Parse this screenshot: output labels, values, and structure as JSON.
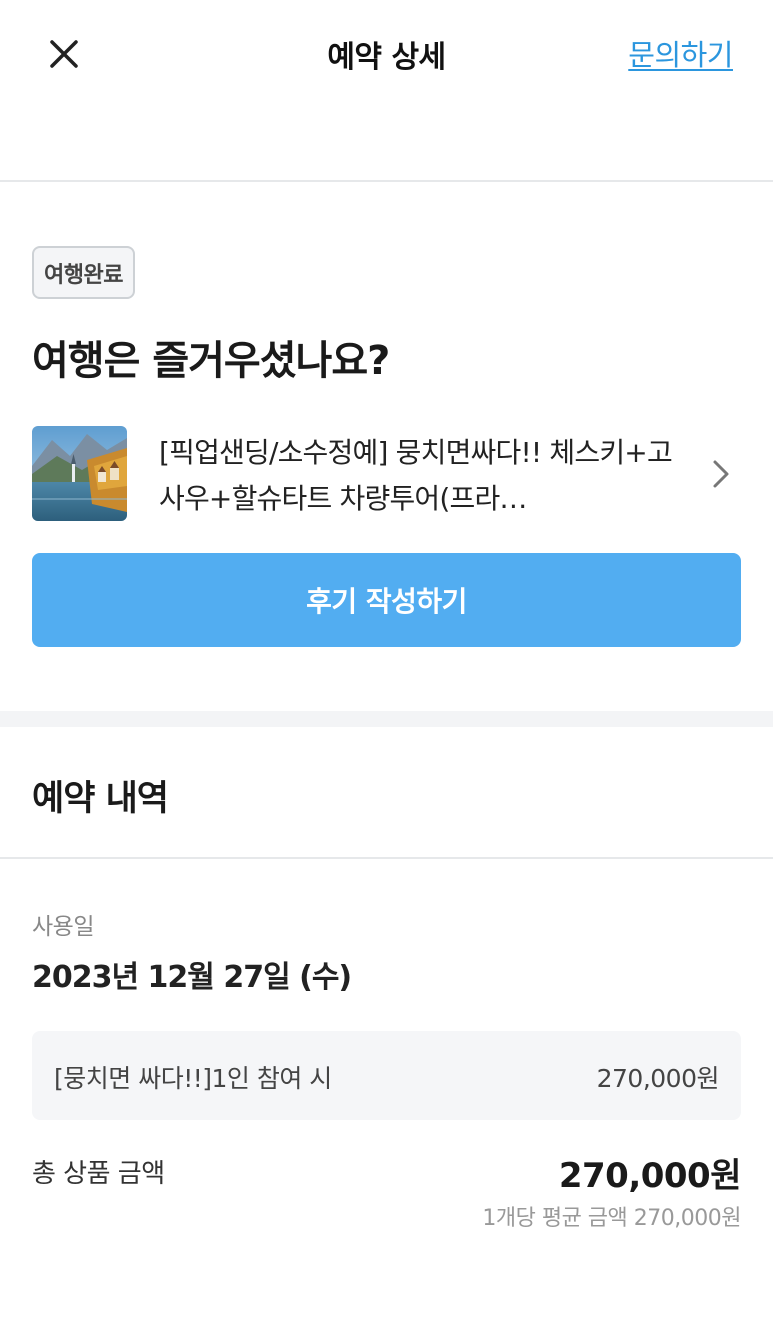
{
  "header": {
    "title": "예약 상세",
    "inquiry_label": "문의하기"
  },
  "status": {
    "badge": "여행완료",
    "headline": "여행은 즐거우셨나요?"
  },
  "product": {
    "title": "[픽업샌딩/소수정예] 뭉치면싸다!! 체스키+고사우+할슈타트 차량투어(프라…"
  },
  "review_button": {
    "label": "후기 작성하기"
  },
  "reservation": {
    "section_title": "예약 내역",
    "use_date_label": "사용일",
    "use_date": "2023년 12월 27일 (수)",
    "option": {
      "name": "[뭉치면 싸다!!]1인 참여 시",
      "price": "270,000원"
    },
    "total_label": "총 상품 금액",
    "total_price": "270,000원",
    "average_price": "1개당 평균 금액 270,000원"
  }
}
